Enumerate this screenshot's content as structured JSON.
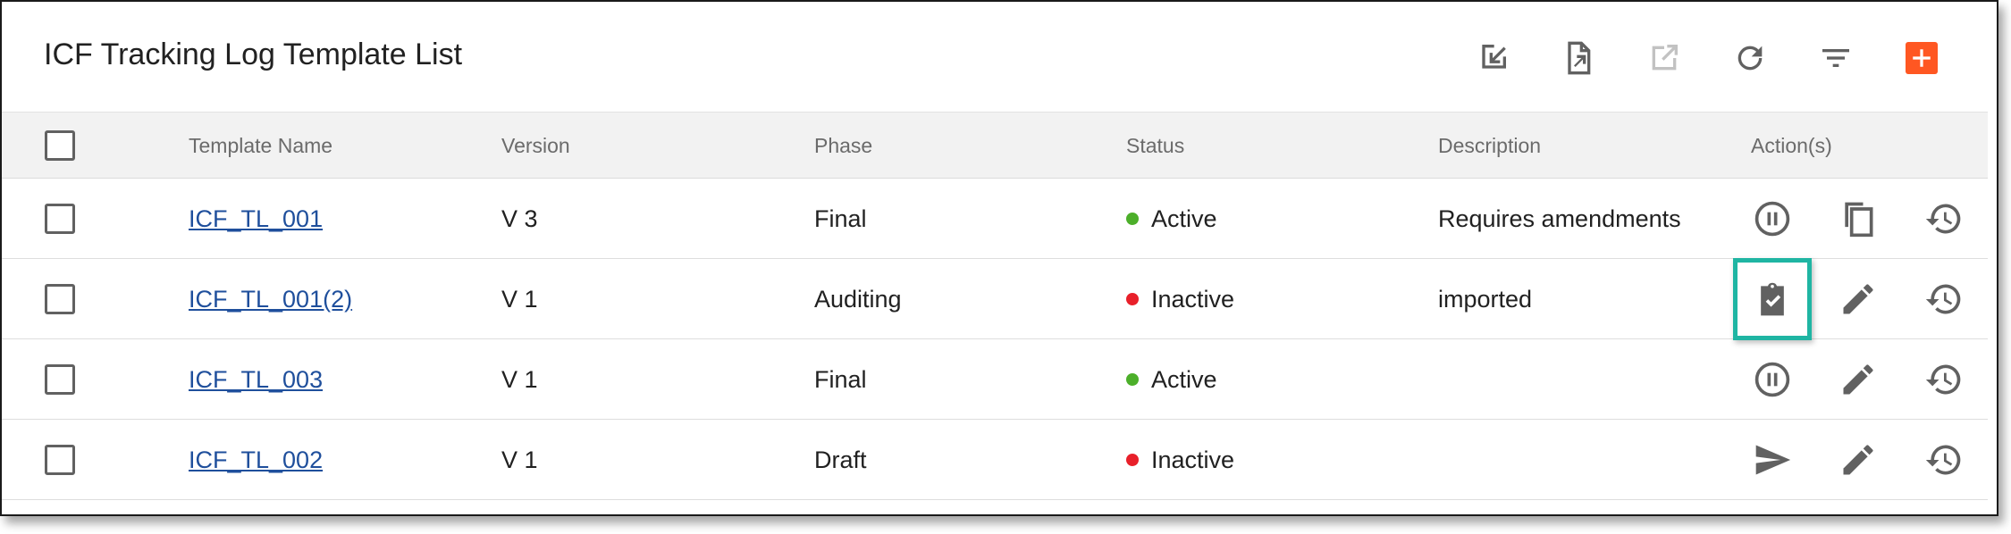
{
  "page": {
    "title": "ICF Tracking Log Template List"
  },
  "toolbar": {
    "icons": [
      "import-icon",
      "export-icon",
      "open-external-icon",
      "refresh-icon",
      "filter-icon",
      "add-icon"
    ]
  },
  "table": {
    "columns": [
      "Template Name",
      "Version",
      "Phase",
      "Status",
      "Description",
      "Action(s)"
    ],
    "rows": [
      {
        "name": "ICF_TL_001",
        "version": "V 3",
        "phase": "Final",
        "status": "Active",
        "description": "Requires amendments",
        "actions": [
          "pause-icon",
          "copy-icon",
          "history-icon"
        ]
      },
      {
        "name": "ICF_TL_001(2)",
        "version": "V 1",
        "phase": "Auditing",
        "status": "Inactive",
        "description": "imported",
        "actions": [
          "clipboard-check-icon",
          "edit-icon",
          "history-icon"
        ]
      },
      {
        "name": "ICF_TL_003",
        "version": "V 1",
        "phase": "Final",
        "status": "Active",
        "description": "",
        "actions": [
          "pause-icon",
          "edit-icon",
          "history-icon"
        ]
      },
      {
        "name": "ICF_TL_002",
        "version": "V 1",
        "phase": "Draft",
        "status": "Inactive",
        "description": "",
        "actions": [
          "send-icon",
          "edit-icon",
          "history-icon"
        ]
      }
    ]
  },
  "colors": {
    "active": "#4caf2a",
    "inactive": "#e8202a",
    "add_button": "#ff5722",
    "highlight": "#1fb5a3",
    "link": "#1f4f9c"
  }
}
